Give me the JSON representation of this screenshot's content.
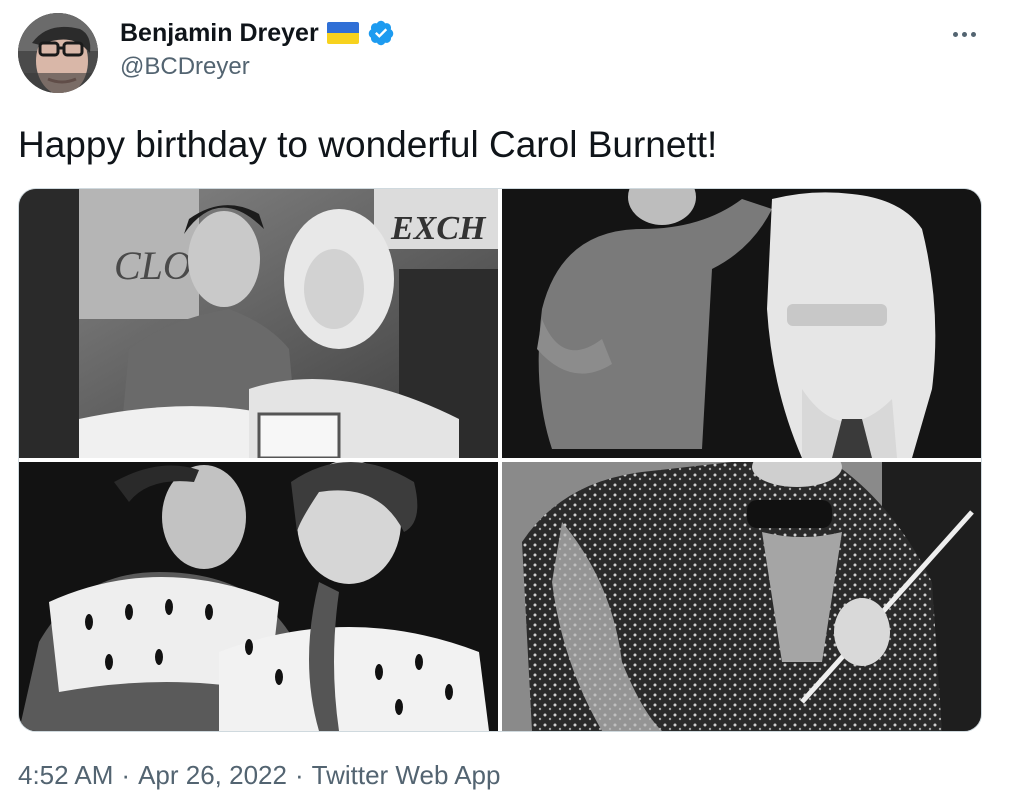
{
  "author": {
    "display_name": "Benjamin Dreyer",
    "handle": "@BCDreyer",
    "flag_colors": {
      "top": "#2f6fd6",
      "bottom": "#f7d21e"
    },
    "verified_color": "#1d9bf0"
  },
  "tweet": {
    "text": "Happy birthday to wonderful Carol Burnett!",
    "time": "4:52 AM",
    "separator": "·",
    "date": "Apr 26, 2022",
    "source": "Twitter Web App"
  },
  "media": [
    {
      "sign_text": "EXCH",
      "sign_text_left": "CLOS"
    },
    {},
    {},
    {}
  ],
  "colors": {
    "text_primary": "#0f1419",
    "text_secondary": "#536471",
    "border": "#cfd9de"
  }
}
